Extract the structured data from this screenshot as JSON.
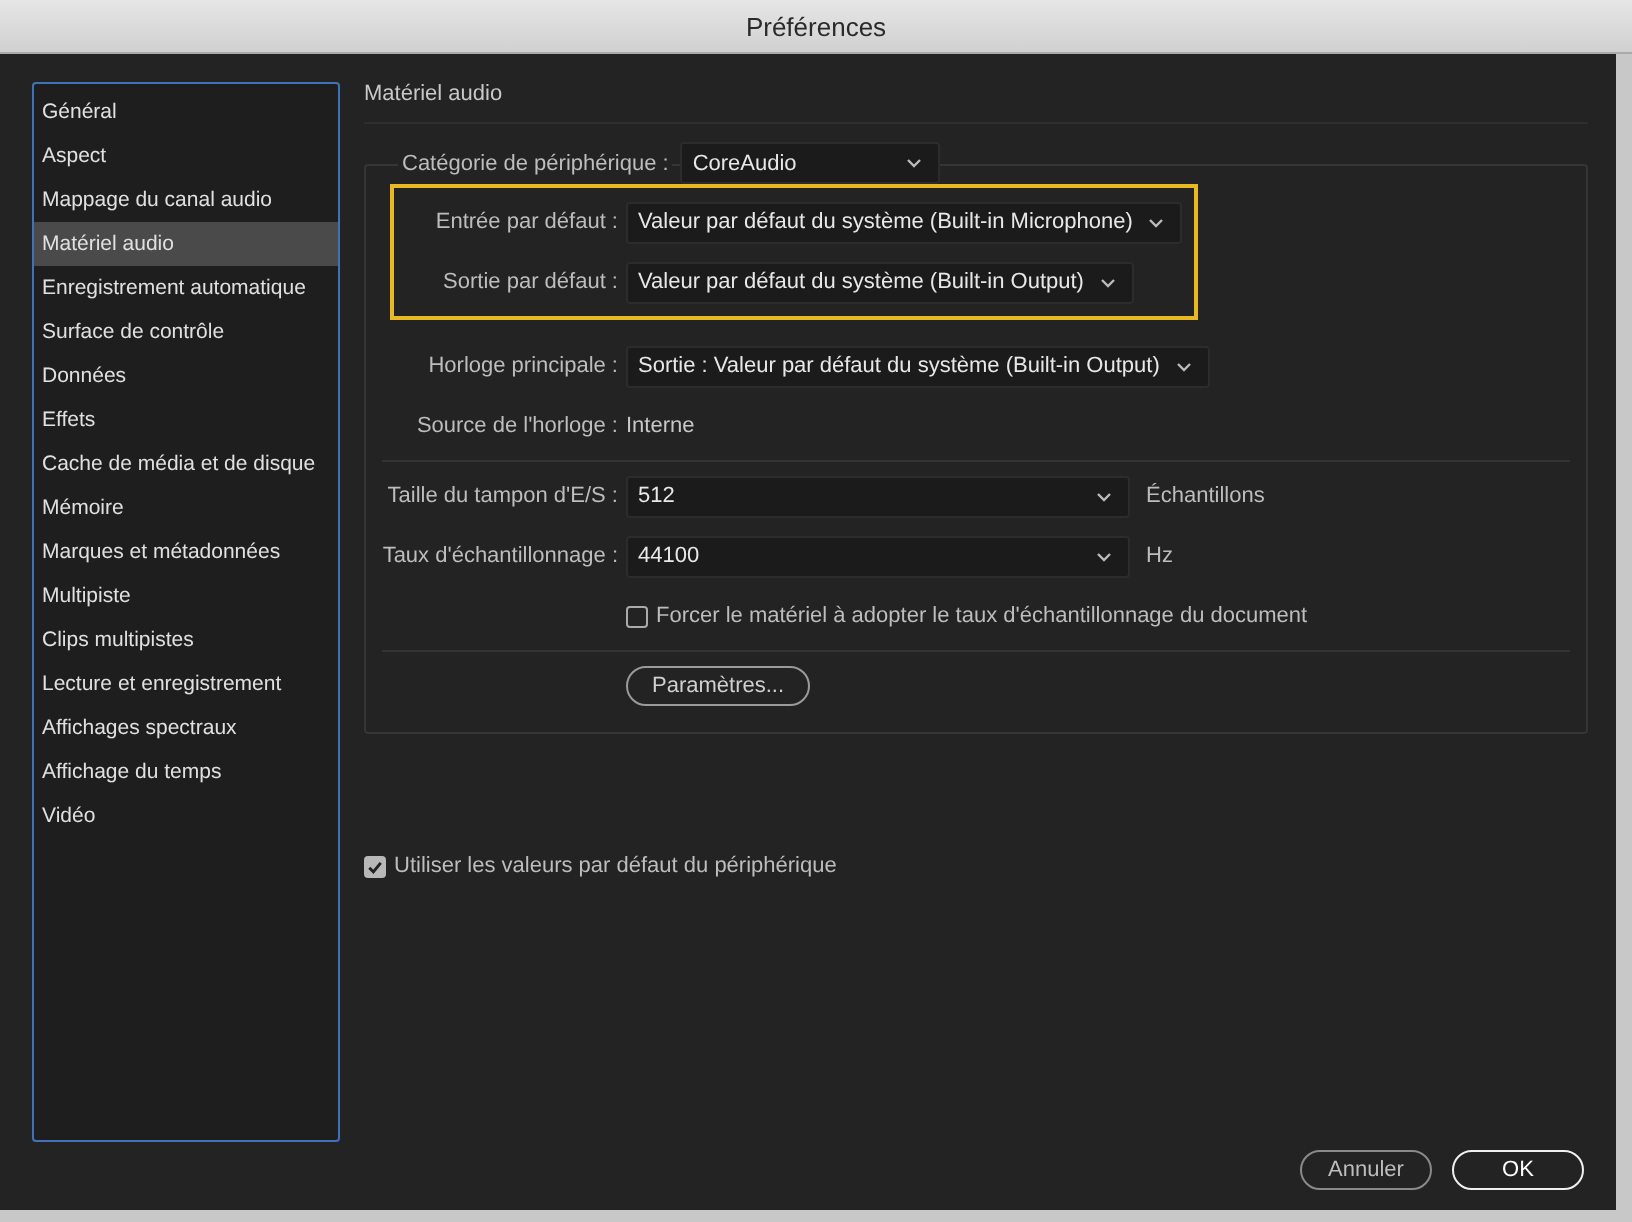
{
  "window": {
    "title": "Préférences"
  },
  "sidebar": {
    "items": [
      {
        "label": "Général",
        "selected": false
      },
      {
        "label": "Aspect",
        "selected": false
      },
      {
        "label": "Mappage du canal audio",
        "selected": false
      },
      {
        "label": "Matériel audio",
        "selected": true
      },
      {
        "label": "Enregistrement automatique",
        "selected": false
      },
      {
        "label": "Surface de contrôle",
        "selected": false
      },
      {
        "label": "Données",
        "selected": false
      },
      {
        "label": "Effets",
        "selected": false
      },
      {
        "label": "Cache de média et de disque",
        "selected": false
      },
      {
        "label": "Mémoire",
        "selected": false
      },
      {
        "label": "Marques et métadonnées",
        "selected": false
      },
      {
        "label": "Multipiste",
        "selected": false
      },
      {
        "label": "Clips multipistes",
        "selected": false
      },
      {
        "label": "Lecture et enregistrement",
        "selected": false
      },
      {
        "label": "Affichages spectraux",
        "selected": false
      },
      {
        "label": "Affichage du temps",
        "selected": false
      },
      {
        "label": "Vidéo",
        "selected": false
      }
    ]
  },
  "section_title": "Matériel audio",
  "device_category": {
    "label": "Catégorie de périphérique :",
    "value": "CoreAudio"
  },
  "groups": [
    {
      "highlighted": true,
      "fields": [
        {
          "kind": "select",
          "label": "Entrée par défaut :",
          "value": "Valeur par défaut du système (Built-in Microphone)"
        },
        {
          "kind": "select",
          "label": "Sortie par défaut :",
          "value": "Valeur par défaut du système (Built-in Output)"
        }
      ]
    },
    {
      "fields": [
        {
          "kind": "select",
          "label": "Horloge principale :",
          "value": "Sortie : Valeur par défaut du système (Built-in Output)"
        },
        {
          "kind": "text",
          "label": "Source de l'horloge :",
          "value": "Interne"
        }
      ]
    },
    {
      "fields": [
        {
          "kind": "select",
          "label": "Taille du tampon d'E/S :",
          "value": "512",
          "unit": "Échantillons"
        },
        {
          "kind": "select",
          "label": "Taux d'échantillonnage :",
          "value": "44100",
          "unit": "Hz"
        },
        {
          "kind": "checkbox",
          "label": "Forcer le matériel à adopter le taux d'échantillonnage du document",
          "checked": false
        }
      ]
    },
    {
      "fields": [
        {
          "kind": "button",
          "label": "Paramètres..."
        }
      ]
    }
  ],
  "use_defaults": {
    "label": "Utiliser les valeurs par défaut du périphérique",
    "checked": true
  },
  "buttons": [
    {
      "label": "Annuler",
      "kind": "secondary"
    },
    {
      "label": "OK",
      "kind": "primary"
    }
  ]
}
